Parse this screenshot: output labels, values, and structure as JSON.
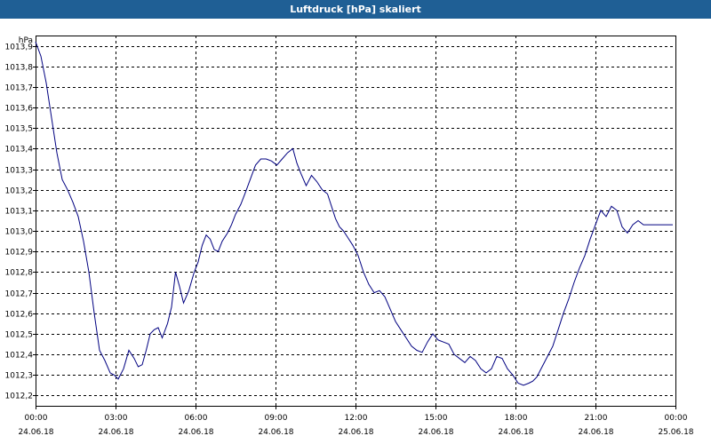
{
  "window": {
    "title": "Luftdruck [hPa] skaliert"
  },
  "chart_data": {
    "type": "line",
    "title": "Luftdruck [hPa] skaliert",
    "ylabel": "hPa",
    "xlabel": "",
    "ylim": [
      1012.15,
      1013.95
    ],
    "y_ticks": [
      1012.2,
      1012.3,
      1012.4,
      1012.5,
      1012.6,
      1012.7,
      1012.8,
      1012.9,
      1013.0,
      1013.1,
      1013.2,
      1013.3,
      1013.4,
      1013.5,
      1013.6,
      1013.7,
      1013.8,
      1013.9
    ],
    "y_tick_labels": [
      "1012,2",
      "1012,3",
      "1012,4",
      "1012,5",
      "1012,6",
      "1012,7",
      "1012,8",
      "1012,9",
      "1013,0",
      "1013,1",
      "1013,2",
      "1013,3",
      "1013,4",
      "1013,5",
      "1013,6",
      "1013,7",
      "1013,8",
      "1013,9"
    ],
    "x_range_hours": [
      0,
      24
    ],
    "x_ticks": [
      {
        "hours": 0,
        "time": "00:00",
        "date": "24.06.18"
      },
      {
        "hours": 3,
        "time": "03:00",
        "date": "24.06.18"
      },
      {
        "hours": 6,
        "time": "06:00",
        "date": "24.06.18"
      },
      {
        "hours": 9,
        "time": "09:00",
        "date": "24.06.18"
      },
      {
        "hours": 12,
        "time": "12:00",
        "date": "24.06.18"
      },
      {
        "hours": 15,
        "time": "15:00",
        "date": "24.06.18"
      },
      {
        "hours": 18,
        "time": "18:00",
        "date": "24.06.18"
      },
      {
        "hours": 21,
        "time": "21:00",
        "date": "24.06.18"
      },
      {
        "hours": 24,
        "time": "00:00",
        "date": "25.06.18"
      }
    ],
    "grid": true,
    "line_color": "#000080",
    "series": [
      {
        "x": [
          0.0,
          0.2,
          0.4,
          0.6,
          0.8,
          1.0,
          1.2,
          1.4,
          1.6,
          1.8,
          2.0,
          2.2,
          2.4,
          2.6,
          2.8,
          2.95,
          3.1,
          3.3,
          3.5,
          3.7,
          3.85,
          4.0,
          4.15,
          4.3,
          4.45,
          4.6,
          4.75,
          4.95,
          5.1,
          5.25,
          5.4,
          5.55,
          5.75,
          5.95,
          6.1,
          6.25,
          6.4,
          6.55,
          6.7,
          6.85,
          7.0,
          7.2,
          7.35,
          7.5,
          7.7,
          7.85,
          8.05,
          8.25,
          8.45,
          8.65,
          8.85,
          9.05,
          9.25,
          9.45,
          9.65,
          9.8,
          9.95,
          10.15,
          10.35,
          10.55,
          10.75,
          10.95,
          11.1,
          11.25,
          11.4,
          11.55,
          11.7,
          11.9,
          12.1,
          12.3,
          12.5,
          12.7,
          12.9,
          13.1,
          13.3,
          13.5,
          13.7,
          13.9,
          14.1,
          14.3,
          14.5,
          14.7,
          14.9,
          15.1,
          15.3,
          15.5,
          15.7,
          15.9,
          16.1,
          16.3,
          16.5,
          16.7,
          16.9,
          17.1,
          17.3,
          17.5,
          17.7,
          17.9,
          18.1,
          18.3,
          18.5,
          18.65,
          18.8,
          19.0,
          19.2,
          19.4,
          19.6,
          19.8,
          20.0,
          20.2,
          20.4,
          20.6,
          20.8,
          21.0,
          21.2,
          21.4,
          21.6,
          21.8,
          22.0,
          22.2,
          22.4,
          22.6,
          22.8,
          22.95,
          23.1,
          23.3,
          23.5,
          23.7,
          23.9
        ],
        "y": [
          1013.92,
          1013.85,
          1013.72,
          1013.55,
          1013.38,
          1013.25,
          1013.2,
          1013.14,
          1013.07,
          1012.95,
          1012.8,
          1012.6,
          1012.42,
          1012.37,
          1012.31,
          1012.3,
          1012.28,
          1012.33,
          1012.42,
          1012.38,
          1012.34,
          1012.35,
          1012.42,
          1012.5,
          1012.52,
          1012.53,
          1012.48,
          1012.55,
          1012.63,
          1012.8,
          1012.73,
          1012.65,
          1012.71,
          1012.8,
          1012.85,
          1012.93,
          1012.98,
          1012.96,
          1012.91,
          1012.9,
          1012.95,
          1012.99,
          1013.03,
          1013.08,
          1013.13,
          1013.18,
          1013.25,
          1013.32,
          1013.35,
          1013.35,
          1013.34,
          1013.32,
          1013.35,
          1013.38,
          1013.4,
          1013.33,
          1013.28,
          1013.22,
          1013.27,
          1013.24,
          1013.2,
          1013.18,
          1013.12,
          1013.06,
          1013.02,
          1013.0,
          1012.97,
          1012.93,
          1012.88,
          1012.8,
          1012.74,
          1012.7,
          1012.71,
          1012.68,
          1012.62,
          1012.56,
          1012.52,
          1012.48,
          1012.44,
          1012.42,
          1012.41,
          1012.46,
          1012.5,
          1012.47,
          1012.46,
          1012.45,
          1012.4,
          1012.38,
          1012.36,
          1012.39,
          1012.37,
          1012.33,
          1012.31,
          1012.33,
          1012.39,
          1012.38,
          1012.33,
          1012.3,
          1012.26,
          1012.25,
          1012.26,
          1012.27,
          1012.29,
          1012.34,
          1012.39,
          1012.44,
          1012.52,
          1012.6,
          1012.67,
          1012.75,
          1012.82,
          1012.88,
          1012.96,
          1013.03,
          1013.1,
          1013.07,
          1013.12,
          1013.1,
          1013.02,
          1012.99,
          1013.03,
          1013.05,
          1013.03,
          1013.03,
          1013.03,
          1013.03,
          1013.03,
          1013.03,
          1013.03
        ]
      }
    ]
  }
}
